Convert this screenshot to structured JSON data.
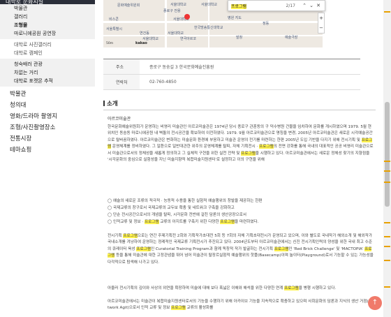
{
  "sidebar": {
    "header": "대학로 문화시설",
    "sub_items": [
      "박물관",
      "갤러리",
      "조형물",
      "마로니에공원 공연장"
    ],
    "active_index": 2,
    "plain_items": [
      "대학로 사진갤러리",
      "대학로 캠페인"
    ],
    "sub2_items": [
      "청숙배러 관광",
      "차없는 거리",
      "대학로 포켓몬 추적"
    ],
    "main_items": [
      "박물관",
      "청의대",
      "영화/드라마 촬영지",
      "조형/사진촬영장소",
      "전통시장",
      "테마쇼핑"
    ]
  },
  "map": {
    "labels": [
      "문화예술위원회",
      "서울대학교",
      "서울대학교",
      "종로구 전용",
      "한국방송통신대학교",
      "비스콘",
      "서울대학교",
      "서울특별시",
      "연건동",
      "서울대학교",
      "병원 지도",
      "정동",
      "예술극장",
      "발창",
      "연극아르코",
      "서울대학교"
    ],
    "provider": "kakao",
    "scale": "50m"
  },
  "findbar": {
    "query": "프로그램",
    "count": "2/17",
    "prev_icon": "chevron-up-icon",
    "next_icon": "chevron-down-icon",
    "close_icon": "close-icon"
  },
  "zoom": {
    "plus": "+",
    "minus": "−"
  },
  "info": {
    "rows": [
      {
        "key": "주소",
        "value": "종로구 동숭길 3 한국문화예술진흥원"
      },
      {
        "key": "연락처",
        "value": "02-760-4850"
      }
    ]
  },
  "intro": {
    "title": "소개",
    "subtitle": "아르코미술관",
    "highlight_word": "프로그램",
    "p1": "한국문화예술위원회가 운영하는 비영리 미술관인 아르코미술관은 1974년 당시 종로구 관훈동의 구 덕수병원 건물을 임차하여 문화를 개시하였으며 1979. 5월 현 위치인 동숭동 마로니에공원 내 벽돌의 전시공간을 확보하여 이전하였다. 1979. 9월 아르코미술관으로 명칭을 변경, 2005년 아르코미술관은 새로운 시각예술공간으로 탈바꿈하였다. 아르코미술관은 변화하는 미술문화 환경에 부응하고 미술관 운영의 전기를 마련하는 한편 2005년 도입 기반을 다지기 위해 전시기획 및 [[프로그램]] 운영체계를 정비하였다. 그 일환으로 일반대관한 위주의 운영체계를 탈피, 자체 기획전시 · [[프로그램]]의 전면 강화를 통해 국내의 대표적인 공공 비영리 미술관으로서 미술관으로서의 정체성을 새롭게 정의하고 그 실체적 구현을 위한 실천 전략 및 [[프로그램]]을 시행하고 있다. 아르코미술관에서는 새로운 정체성 찾기의 지향점을 '시각문화의 중심으로 실험성을 지닌 미술지향적 복합미술지원센터'로 설정하고 이의 구현을 위해"
  },
  "bullets": [
    "◯ 예술의 새로운 조류의 적극적 · 능동적 수용을 통한 실험적 예술행위의 창발을 제공하는 한편",
    "◯ 국제교류의 창구로서 국제교류의 교두보 확충 및 네트워크 구축을 강화하고",
    "◯ 단순 전시공간으로서의 개념을 탈피, 시각문화 전반에 걸친 담론의 생산공장으로서",
    "◯ 인적교류 및 정보 · [[프로그램]] 교류의 아지트를 구축키 위한 다양한 [[프로그램]]을 마련하였다."
  ],
  "p2": "전시기획 [[프로그램]]으로는 연간 주제기획전 2회와 기획작가초대전 5회 등 7회의 자체 기획초대전시가 운영되고 있으며, 이와 별도로 국내작가 해외소개 및 해외작가 국내소개를 겨냥하여 운영하는 정례적인 국제교류 기획전시가 추진되고 있다. 2004년도부터 아르코미술관에서는 신진 전시기획인력의 양성을 위한 국내 최고 수준의 큐레이터 육성 [[프로그램]]인 Curatorial Training Program과 함께 독창적 작가 발굴하는 전시기획 [[프로그램]]인 'Red Brick Challenge' 및 'MACTOPIA' [[프로그램]] 등을 통해 미술관에 대한 고정관념을 뛰어 넘어 미술관이 탈장르실험적 예술행위의 핫플(Basecamp)이며 놀이터(Playground)로서 기능할 수 있는 가능성을 다각적으로 탐색해 나가고 있다.",
  "p3": "아울러 전시기획의 깊이와 사상의 외연을 확장하며 미술에 대해 보다 폭넓은 이해와 해석을 위한 다양한 연계 [[프로그램]]을 병행 시행하고 있다.",
  "p4": "아르코미술관에서는 미술관이 복합미술지원센터로서의 기능을 수행하기 위해 아카이브 기능을 지속적으로 확충하고 있으며 사회문화의 담론과 지식의 생산 거점(Network Agit)으로서 인적 교류 및 정보 [[프로그램]] 교류의 활성화를"
}
